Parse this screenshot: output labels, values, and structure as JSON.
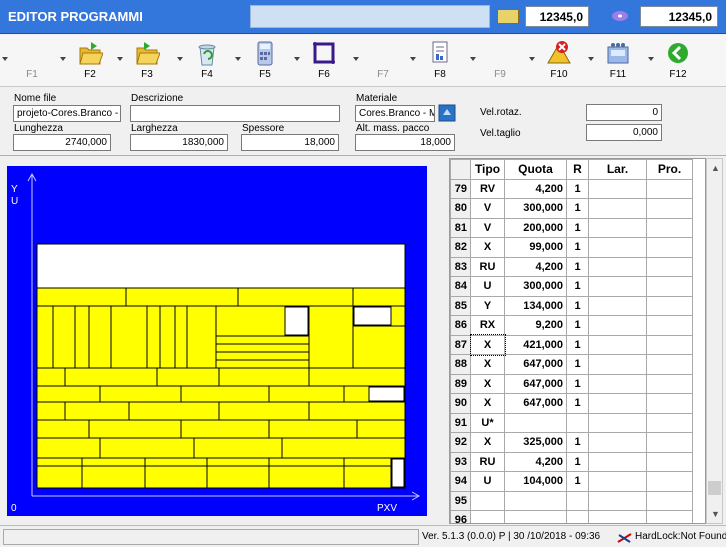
{
  "app": {
    "title": "EDITOR PROGRAMMI"
  },
  "header": {
    "counter1": "12345,0",
    "counter2": "12345,0"
  },
  "toolbar": {
    "buttons": [
      {
        "label": "F1",
        "icon": "blank-icon",
        "enabled": false
      },
      {
        "label": "F2",
        "icon": "open-folder-icon",
        "enabled": true
      },
      {
        "label": "F3",
        "icon": "folder-icon",
        "enabled": true
      },
      {
        "label": "F4",
        "icon": "recycle-bin-icon",
        "enabled": true
      },
      {
        "label": "F5",
        "icon": "calculator-icon",
        "enabled": true
      },
      {
        "label": "F6",
        "icon": "frame-icon",
        "enabled": true
      },
      {
        "label": "F7",
        "icon": "blank-icon",
        "enabled": false
      },
      {
        "label": "F8",
        "icon": "report-icon",
        "enabled": true
      },
      {
        "label": "F9",
        "icon": "blank-icon",
        "enabled": false
      },
      {
        "label": "F10",
        "icon": "warning-delete-icon",
        "enabled": true
      },
      {
        "label": "F11",
        "icon": "machine-icon",
        "enabled": true
      },
      {
        "label": "F12",
        "icon": "back-arrow-icon",
        "enabled": true
      }
    ]
  },
  "fields": {
    "nome_file": {
      "label": "Nome file",
      "value": "projeto-Cores.Branco -"
    },
    "descrizione": {
      "label": "Descrizione",
      "value": ""
    },
    "materiale": {
      "label": "Materiale",
      "value": "Cores.Branco - M"
    },
    "lunghezza": {
      "label": "Lunghezza",
      "value": "2740,000"
    },
    "larghezza": {
      "label": "Larghezza",
      "value": "1830,000"
    },
    "spessore": {
      "label": "Spessore",
      "value": "18,000"
    },
    "alt_mass": {
      "label": "Alt. mass. pacco",
      "value": "18,000"
    },
    "vel_rotaz": {
      "label": "Vel.rotaz.",
      "value": "0"
    },
    "vel_taglio": {
      "label": "Vel.taglio",
      "value": "0,000"
    }
  },
  "canvas": {
    "axis_y": "Y",
    "axis_u": "U",
    "origin": "0",
    "axis_pxv": "PXV"
  },
  "grid": {
    "headers": [
      "Tipo",
      "Quota",
      "R",
      "Lar.",
      "Pro."
    ],
    "rows": [
      {
        "n": "79",
        "tipo": "RV",
        "quota": "4,200",
        "r": "1",
        "lar": "",
        "pro": ""
      },
      {
        "n": "80",
        "tipo": "V",
        "quota": "300,000",
        "r": "1",
        "lar": "",
        "pro": ""
      },
      {
        "n": "81",
        "tipo": "V",
        "quota": "200,000",
        "r": "1",
        "lar": "",
        "pro": ""
      },
      {
        "n": "82",
        "tipo": "X",
        "quota": "99,000",
        "r": "1",
        "lar": "",
        "pro": ""
      },
      {
        "n": "83",
        "tipo": "RU",
        "quota": "4,200",
        "r": "1",
        "lar": "",
        "pro": ""
      },
      {
        "n": "84",
        "tipo": "U",
        "quota": "300,000",
        "r": "1",
        "lar": "",
        "pro": ""
      },
      {
        "n": "85",
        "tipo": "Y",
        "quota": "134,000",
        "r": "1",
        "lar": "",
        "pro": ""
      },
      {
        "n": "86",
        "tipo": "RX",
        "quota": "9,200",
        "r": "1",
        "lar": "",
        "pro": ""
      },
      {
        "n": "87",
        "tipo": "X",
        "quota": "421,000",
        "r": "1",
        "lar": "",
        "pro": ""
      },
      {
        "n": "88",
        "tipo": "X",
        "quota": "647,000",
        "r": "1",
        "lar": "",
        "pro": ""
      },
      {
        "n": "89",
        "tipo": "X",
        "quota": "647,000",
        "r": "1",
        "lar": "",
        "pro": ""
      },
      {
        "n": "90",
        "tipo": "X",
        "quota": "647,000",
        "r": "1",
        "lar": "",
        "pro": ""
      },
      {
        "n": "91",
        "tipo": "U*",
        "quota": "",
        "r": "",
        "lar": "",
        "pro": ""
      },
      {
        "n": "92",
        "tipo": "X",
        "quota": "325,000",
        "r": "1",
        "lar": "",
        "pro": ""
      },
      {
        "n": "93",
        "tipo": "RU",
        "quota": "4,200",
        "r": "1",
        "lar": "",
        "pro": ""
      },
      {
        "n": "94",
        "tipo": "U",
        "quota": "104,000",
        "r": "1",
        "lar": "",
        "pro": ""
      },
      {
        "n": "95",
        "tipo": "",
        "quota": "",
        "r": "",
        "lar": "",
        "pro": ""
      },
      {
        "n": "96",
        "tipo": "",
        "quota": "",
        "r": "",
        "lar": "",
        "pro": ""
      }
    ]
  },
  "status": {
    "version": "Ver. 5.1.3 (0.0.0) P",
    "datetime": "30 /10/2018  -  09:36",
    "lock": "HardLock:Not Found"
  },
  "colors": {
    "canvas": "#0000ff",
    "panel": "#ffff00",
    "title": "#3377dd"
  }
}
